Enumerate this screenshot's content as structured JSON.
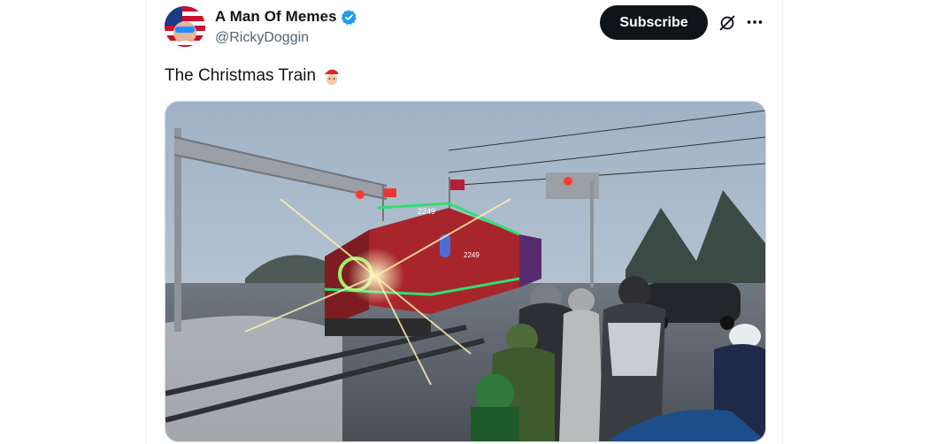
{
  "author": {
    "display_name": "A Man Of Memes",
    "handle": "@RickyDoggin",
    "verified": true,
    "avatar_icon": "avatar-flag-sunglasses"
  },
  "actions": {
    "subscribe_label": "Subscribe",
    "grok_icon": "grok-icon",
    "more_icon": "more-icon"
  },
  "post": {
    "text": "The Christmas Train",
    "emoji": "santa-icon",
    "media_description_icon": "video-thumbnail"
  },
  "media": {
    "locomotive_number_front": "2249",
    "locomotive_number_side": "2249"
  },
  "colors": {
    "accent": "#0f1419",
    "verified": "#1d9bf0",
    "secondary_text": "#536471"
  }
}
